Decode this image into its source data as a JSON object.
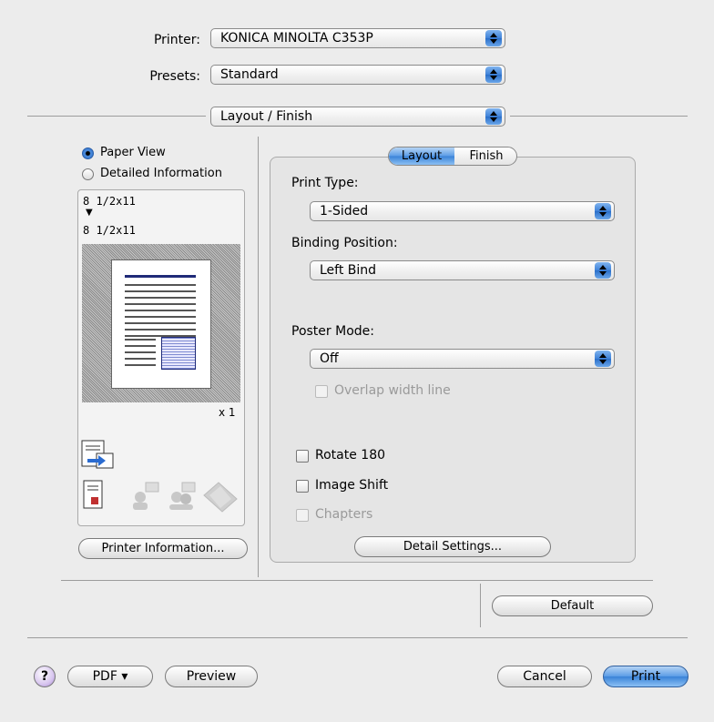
{
  "printer": {
    "label": "Printer:",
    "value": "KONICA MINOLTA C353P"
  },
  "presets": {
    "label": "Presets:",
    "value": "Standard"
  },
  "panel_menu": {
    "value": "Layout / Finish"
  },
  "view_options": {
    "paper_view": "Paper View",
    "detailed_info": "Detailed Information",
    "selected": "Paper View"
  },
  "preview": {
    "input_size": "8 1/2x11",
    "arrow": "▼",
    "output_size": "8 1/2x11",
    "copies": "x 1"
  },
  "printer_info_button": "Printer Information...",
  "tabs": {
    "active": "Layout",
    "items": [
      "Layout",
      "Finish"
    ]
  },
  "print_type": {
    "label": "Print Type:",
    "value": "1-Sided"
  },
  "binding_position": {
    "label": "Binding Position:",
    "value": "Left Bind"
  },
  "poster_mode": {
    "label": "Poster Mode:",
    "value": "Off"
  },
  "overlap_width_line": {
    "label": "Overlap width line",
    "checked": false,
    "enabled": false
  },
  "rotate_180": {
    "label": "Rotate 180",
    "checked": false
  },
  "image_shift": {
    "label": "Image Shift",
    "checked": false
  },
  "chapters": {
    "label": "Chapters",
    "checked": false,
    "enabled": false
  },
  "detail_settings_button": "Detail Settings...",
  "default_button": "Default",
  "footer": {
    "help": "?",
    "pdf": "PDF ▾",
    "preview": "Preview",
    "cancel": "Cancel",
    "print": "Print"
  },
  "colors": {
    "accent": "#3a83d8",
    "background": "#ececec"
  }
}
